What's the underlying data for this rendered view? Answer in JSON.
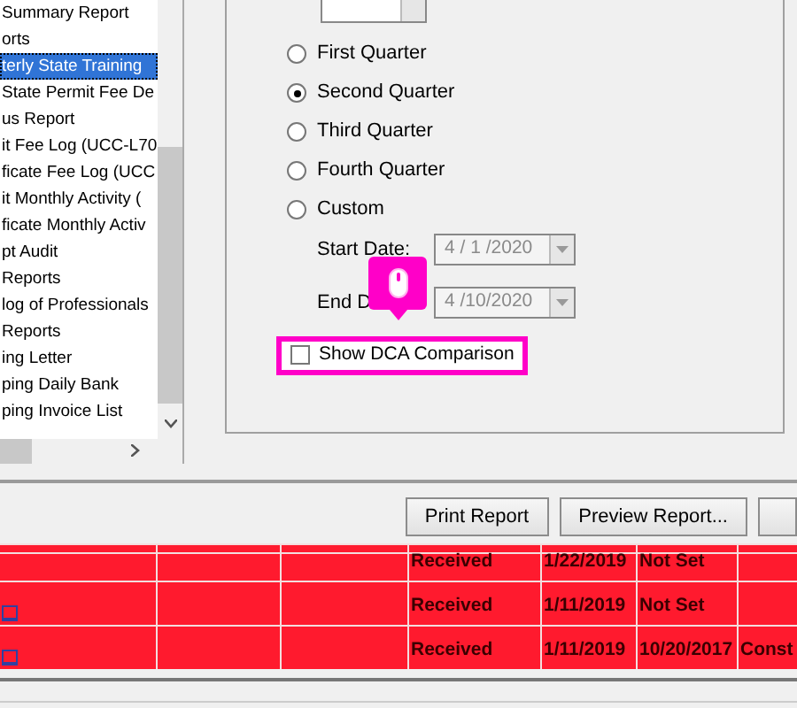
{
  "report_list": {
    "items": [
      {
        "label": "Summary Report",
        "selected": false
      },
      {
        "label": "orts",
        "selected": false
      },
      {
        "label": "terly State Training",
        "selected": true
      },
      {
        "label": "State Permit Fee De",
        "selected": false
      },
      {
        "label": "us Report",
        "selected": false
      },
      {
        "label": "it Fee Log (UCC-L70",
        "selected": false
      },
      {
        "label": "ficate Fee Log (UCC",
        "selected": false
      },
      {
        "label": "it Monthly Activity (",
        "selected": false
      },
      {
        "label": "ficate Monthly Activ",
        "selected": false
      },
      {
        "label": "pt Audit",
        "selected": false
      },
      {
        "label": "Reports",
        "selected": false
      },
      {
        "label": "log of Professionals",
        "selected": false
      },
      {
        "label": "Reports",
        "selected": false
      },
      {
        "label": "ing Letter",
        "selected": false
      },
      {
        "label": "ping Daily Bank",
        "selected": false
      },
      {
        "label": "ping Invoice List",
        "selected": false
      }
    ]
  },
  "period_options": [
    {
      "label": "First Quarter",
      "selected": false
    },
    {
      "label": "Second Quarter",
      "selected": true
    },
    {
      "label": "Third Quarter",
      "selected": false
    },
    {
      "label": "Fourth Quarter",
      "selected": false
    },
    {
      "label": "Custom",
      "selected": false
    }
  ],
  "start_date": {
    "label": "Start Date:",
    "value": "4 / 1 /2020",
    "disabled": true
  },
  "end_date": {
    "label": "End D",
    "value": "4 /10/2020",
    "disabled": true
  },
  "dca_checkbox": {
    "label": "Show DCA Comparison",
    "checked": false,
    "highlighted": true
  },
  "buttons": [
    "Print Report",
    "Preview Report..."
  ],
  "grid": {
    "rows": [
      {
        "link": false,
        "status": "Received",
        "date_1": "1/22/2019",
        "date_2": "Not Set",
        "column_7": ""
      },
      {
        "link": true,
        "status": "Received",
        "date_1": "1/11/2019",
        "date_2": "Not Set",
        "column_7": ""
      },
      {
        "link": true,
        "status": "Received",
        "date_1": "1/11/2019",
        "date_2": "10/20/2017",
        "column_7": "Const"
      }
    ]
  }
}
